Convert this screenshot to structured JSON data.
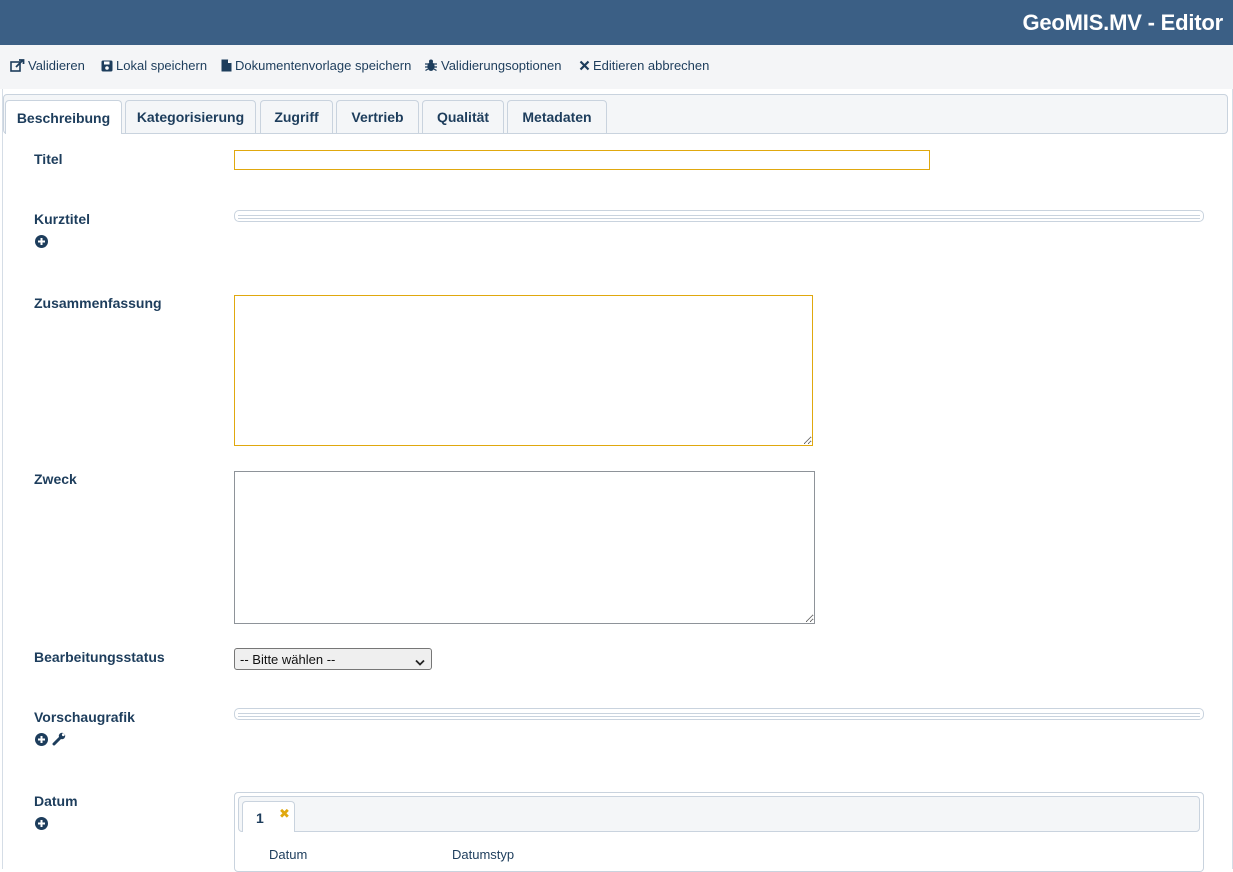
{
  "app": {
    "title": "GeoMIS.MV - Editor"
  },
  "toolbar": {
    "validate": "Validieren",
    "save_local": "Lokal speichern",
    "save_template": "Dokumentenvorlage speichern",
    "validation_options": "Validierungsoptionen",
    "cancel_edit": "Editieren abbrechen"
  },
  "tabs": [
    {
      "label": "Beschreibung",
      "active": true
    },
    {
      "label": "Kategorisierung"
    },
    {
      "label": "Zugriff"
    },
    {
      "label": "Vertrieb"
    },
    {
      "label": "Qualität"
    },
    {
      "label": "Metadaten"
    }
  ],
  "form": {
    "titel": {
      "label": "Titel",
      "value": ""
    },
    "kurztitel": {
      "label": "Kurztitel"
    },
    "zusammenfassung": {
      "label": "Zusammenfassung",
      "value": ""
    },
    "zweck": {
      "label": "Zweck",
      "value": ""
    },
    "bearbeitungsstatus": {
      "label": "Bearbeitungsstatus",
      "selected": "-- Bitte wählen --"
    },
    "vorschaugrafik": {
      "label": "Vorschaugrafik"
    },
    "datum": {
      "label": "Datum",
      "tab_label": "1",
      "remove_symbol": "✖",
      "col_datum": "Datum",
      "col_datumstyp": "Datumstyp"
    }
  },
  "colors": {
    "header_bg": "#3b5f85",
    "toolbar_bg": "#f4f5f7",
    "label_text": "#1d3d5c",
    "required_border": "#e0a80e"
  },
  "icons": {
    "validate": "external-link-icon",
    "save_local": "floppy-disk-icon",
    "save_template": "file-icon",
    "validation_options": "bug-icon",
    "cancel_edit": "close-icon",
    "add": "plus-circle-icon",
    "edit": "wrench-icon"
  }
}
